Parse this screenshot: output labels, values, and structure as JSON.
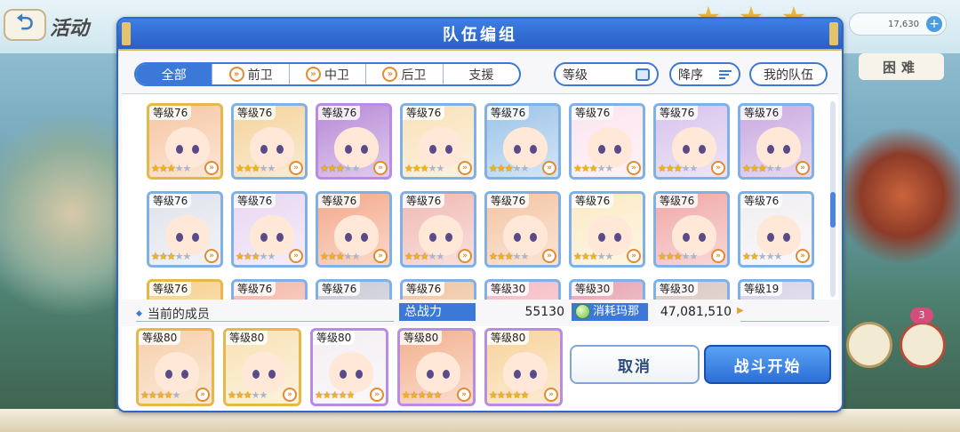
{
  "background": {
    "screen_title": "活动",
    "currency": "17,630",
    "difficulty": "困难"
  },
  "dialog": {
    "title": "队伍编组",
    "tabs": [
      {
        "label": "全部",
        "icon": "",
        "active": true
      },
      {
        "label": "前卫",
        "icon": "front-role-icon",
        "active": false
      },
      {
        "label": "中卫",
        "icon": "middle-role-icon",
        "active": false
      },
      {
        "label": "后卫",
        "icon": "back-role-icon",
        "active": false
      },
      {
        "label": "支援",
        "icon": "",
        "active": false
      }
    ],
    "sort_level_label": "等级",
    "sort_order_label": "降序",
    "my_team_label": "我的队伍",
    "roster": [
      {
        "level": "等级76",
        "stars": 3,
        "frame": "gold",
        "hue": "#f7c6a3"
      },
      {
        "level": "等级76",
        "stars": 3,
        "frame": "blue",
        "hue": "#f5d39b"
      },
      {
        "level": "等级76",
        "stars": 3,
        "frame": "purple",
        "hue": "#b88ad6"
      },
      {
        "level": "等级76",
        "stars": 3,
        "frame": "blue",
        "hue": "#f8e1b8"
      },
      {
        "level": "等级76",
        "stars": 3,
        "frame": "blue",
        "hue": "#9cc4e8"
      },
      {
        "level": "等级76",
        "stars": 3,
        "frame": "blue",
        "hue": "#fce4ee"
      },
      {
        "level": "等级76",
        "stars": 3,
        "frame": "blue",
        "hue": "#d7c3ec"
      },
      {
        "level": "等级76",
        "stars": 3,
        "frame": "blue",
        "hue": "#c9a9e0"
      },
      {
        "level": "等级76",
        "stars": 3,
        "frame": "blue",
        "hue": "#dfe3ea"
      },
      {
        "level": "等级76",
        "stars": 3,
        "frame": "blue",
        "hue": "#e9d6f2"
      },
      {
        "level": "等级76",
        "stars": 3,
        "frame": "blue",
        "hue": "#f3a98a"
      },
      {
        "level": "等级76",
        "stars": 3,
        "frame": "blue",
        "hue": "#f0b9b3"
      },
      {
        "level": "等级76",
        "stars": 3,
        "frame": "blue",
        "hue": "#f4c4a2"
      },
      {
        "level": "等级76",
        "stars": 3,
        "frame": "blue",
        "hue": "#fbeac4"
      },
      {
        "level": "等级76",
        "stars": 3,
        "frame": "blue",
        "hue": "#f0a7a7"
      },
      {
        "level": "等级76",
        "stars": 2,
        "frame": "blue",
        "hue": "#f1eef1"
      },
      {
        "level": "等级76",
        "stars": 0,
        "frame": "gold",
        "hue": "#f7cf8a"
      },
      {
        "level": "等级76",
        "stars": 0,
        "frame": "blue",
        "hue": "#f5b6a8"
      },
      {
        "level": "等级76",
        "stars": 0,
        "frame": "blue",
        "hue": "#c9c9d6"
      },
      {
        "level": "等级76",
        "stars": 0,
        "frame": "blue",
        "hue": "#f0c3a0"
      },
      {
        "level": "等级30",
        "stars": 0,
        "frame": "blue",
        "hue": "#f5b9c2"
      },
      {
        "level": "等级30",
        "stars": 0,
        "frame": "blue",
        "hue": "#e5a3b0"
      },
      {
        "level": "等级30",
        "stars": 0,
        "frame": "blue",
        "hue": "#d7c7c0"
      },
      {
        "level": "等级19",
        "stars": 0,
        "frame": "blue",
        "hue": "#d8d2e6"
      }
    ],
    "current_members_label": "当前的成员",
    "power_label": "总战力",
    "power_value": "55130",
    "mana_label": "消耗玛那",
    "mana_value": "47,081,510",
    "party": [
      {
        "level": "等级80",
        "stars": 4,
        "frame": "gold",
        "hue": "#f6cfa9"
      },
      {
        "level": "等级80",
        "stars": 3,
        "frame": "gold",
        "hue": "#f8e2b5"
      },
      {
        "level": "等级80",
        "stars": 5,
        "frame": "purple",
        "hue": "#f3eef3"
      },
      {
        "level": "等级80",
        "stars": 5,
        "frame": "purple",
        "hue": "#f3b08e"
      },
      {
        "level": "等级80",
        "stars": 5,
        "frame": "purple",
        "hue": "#f7d39a"
      }
    ],
    "cancel_label": "取消",
    "start_label": "战斗开始"
  }
}
